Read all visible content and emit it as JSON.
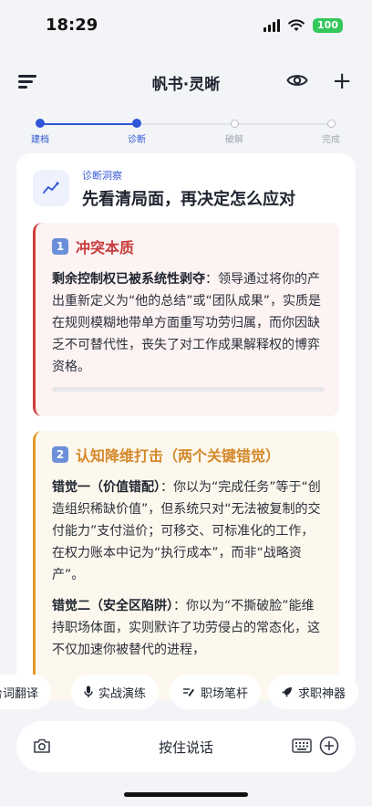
{
  "status": {
    "time": "18:29",
    "battery": "100"
  },
  "header": {
    "title": "帆书·灵晰"
  },
  "stepper": {
    "steps": [
      {
        "label": "建档",
        "state": "done"
      },
      {
        "label": "诊断",
        "state": "current"
      },
      {
        "label": "破解",
        "state": "todo"
      },
      {
        "label": "完成",
        "state": "todo"
      }
    ]
  },
  "card": {
    "subtitle": "诊断洞察",
    "title": "先看清局面，再决定怎么应对",
    "section1": {
      "number": "1",
      "title": "冲突本质",
      "lead": "剩余控制权已被系统性剥夺",
      "body": "：领导通过将你的产出重新定义为“他的总结”或“团队成果”，实质是在规则模糊地带单方面重写功劳归属，而你因缺乏不可替代性，丧失了对工作成果解释权的博弈资格。"
    },
    "section2": {
      "number": "2",
      "title": "认知降维打击（两个关键错觉）",
      "p1_lead": "错觉一（价值错配）",
      "p1_body": "：你以为“完成任务”等于“创造组织稀缺价值”，但系统只对“无法被复制的交付能力”支付溢价；可移交、可标准化的工作，在权力账本中记为“执行成本”，而非“战略资产”。",
      "p2_lead": "错觉二（安全区陷阱）",
      "p2_body": "：你以为“不撕破脸”能维持职场体面，实则默许了功劳侵占的常态化，这不仅加速你被替代的进程，"
    }
  },
  "chips": [
    {
      "label": "台词翻译",
      "icon": "translate-icon"
    },
    {
      "label": "实战演练",
      "icon": "microphone-icon"
    },
    {
      "label": "职场笔杆",
      "icon": "pen-icon"
    },
    {
      "label": "求职神器",
      "icon": "rocket-icon"
    }
  ],
  "input": {
    "talk_label": "按住说话"
  }
}
